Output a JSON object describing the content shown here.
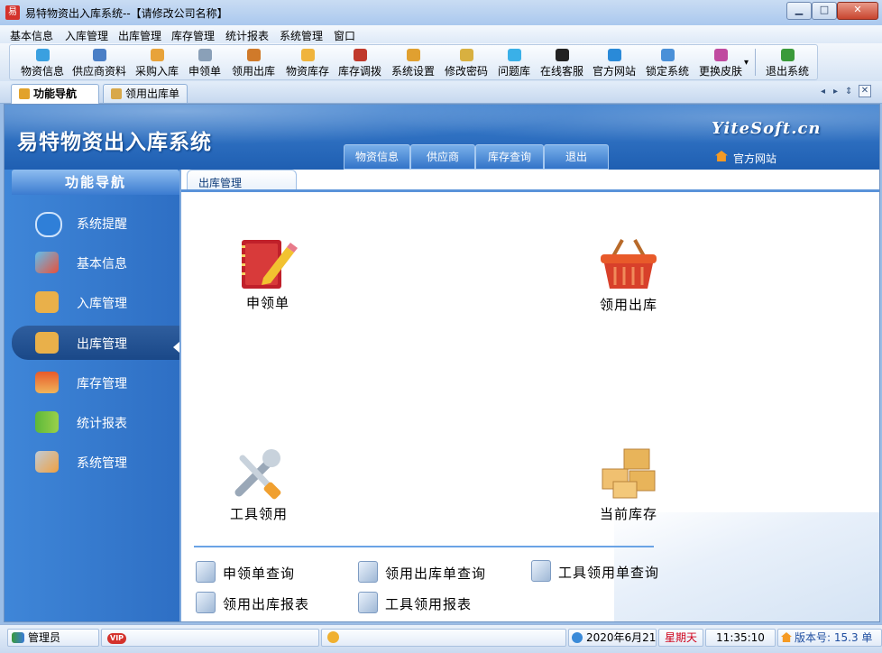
{
  "window": {
    "title": "易特物资出入库系统--【请修改公司名称】",
    "app_icon_text": "易",
    "min": "▁",
    "max": "□",
    "close": "✕"
  },
  "menu": [
    "基本信息",
    "入库管理",
    "出库管理",
    "库存管理",
    "统计报表",
    "系统管理",
    "窗口"
  ],
  "toolbar": {
    "items": [
      {
        "label": "物资信息",
        "icon": "cubes-icon",
        "color": "#3aa0e0"
      },
      {
        "label": "供应商资料",
        "icon": "people-icon",
        "color": "#4a7fc6"
      },
      {
        "label": "采购入库",
        "icon": "truck-icon",
        "color": "#e8a33a"
      },
      {
        "label": "申领单",
        "icon": "calculator-icon",
        "color": "#8aa0b8"
      },
      {
        "label": "领用出库",
        "icon": "cart-icon",
        "color": "#d07a2a"
      },
      {
        "label": "物资库存",
        "icon": "box-icon",
        "color": "#f0b43c"
      },
      {
        "label": "库存调拨",
        "icon": "transfer-icon",
        "color": "#c0392b"
      },
      {
        "label": "系统设置",
        "icon": "settings-icon",
        "color": "#e0a030"
      },
      {
        "label": "修改密码",
        "icon": "key-icon",
        "color": "#d8b040"
      },
      {
        "label": "问题库",
        "icon": "help-icon",
        "color": "#3ab0e8"
      },
      {
        "label": "在线客服",
        "icon": "penguin-icon",
        "color": "#222222"
      },
      {
        "label": "官方网站",
        "icon": "ie-icon",
        "color": "#2a8ad8"
      },
      {
        "label": "锁定系统",
        "icon": "lock-screen-icon",
        "color": "#4a90d8"
      },
      {
        "label": "更换皮肤",
        "icon": "palette-icon",
        "color": "#c04aa0"
      },
      {
        "label": "退出系统",
        "icon": "exit-icon",
        "color": "#3a9a3a"
      }
    ],
    "dropdown": "▾"
  },
  "tabs": [
    {
      "label": "功能导航"
    },
    {
      "label": "领用出库单"
    }
  ],
  "tab_controls": {
    "prev": "◂",
    "next": "▸",
    "list": "⇕",
    "close": "✕"
  },
  "banner": {
    "title": "易特物资出入库系统",
    "brand": "YiteSoft.cn",
    "official_link": "官方网站",
    "tabs": [
      "物资信息",
      "供应商",
      "库存查询",
      "退出"
    ]
  },
  "sidebar": {
    "title": "功能导航",
    "items": [
      {
        "label": "系统提醒",
        "icon": "info-icon",
        "color": "#2f7fd8"
      },
      {
        "label": "基本信息",
        "icon": "cubes-icon",
        "color": "#3aa0e0"
      },
      {
        "label": "入库管理",
        "icon": "box-in-icon",
        "color": "#e9b04a"
      },
      {
        "label": "出库管理",
        "icon": "box-out-icon",
        "color": "#e9b04a"
      },
      {
        "label": "库存管理",
        "icon": "warehouse-icon",
        "color": "#e08a2a"
      },
      {
        "label": "统计报表",
        "icon": "bar-chart-icon",
        "color": "#5cb83a"
      },
      {
        "label": "系统管理",
        "icon": "tools-icon",
        "color": "#8aa0b8"
      }
    ],
    "active_index": 3
  },
  "content": {
    "section_title": "出库管理",
    "big_icons": [
      {
        "label": "申领单",
        "icon": "notebook-icon"
      },
      {
        "label": "领用出库",
        "icon": "basket-icon"
      },
      {
        "label": "工具领用",
        "icon": "wrench-icon"
      },
      {
        "label": "当前库存",
        "icon": "boxes-icon"
      }
    ],
    "links": [
      {
        "label": "申领单查询"
      },
      {
        "label": "领用出库单查询"
      },
      {
        "label": "工具领用单查询"
      },
      {
        "label": "领用出库报表"
      },
      {
        "label": "工具领用报表"
      }
    ]
  },
  "status": {
    "user": "管理员",
    "vip": "VIP",
    "date": "2020年6月21日",
    "weekday": "星期天",
    "time": "11:35:10",
    "version": "版本号: 15.3 单"
  },
  "colors": {
    "banner": "#2a6cc0",
    "sidebar": "#3579cc",
    "weekday": "#d0021b",
    "version": "#1f4ea0"
  }
}
